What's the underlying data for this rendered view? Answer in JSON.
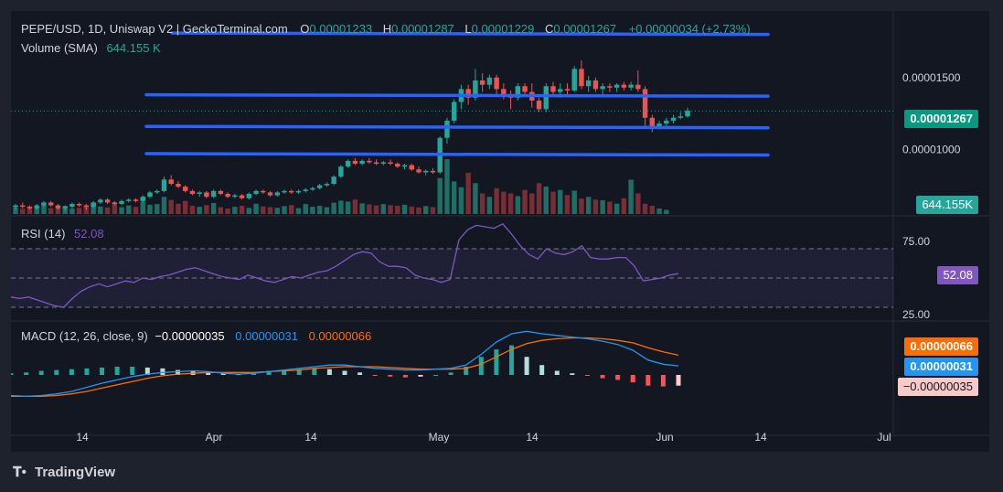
{
  "header": {
    "symbol": "PEPE/USD, 1D, Uniswap V2 | GeckoTerminal.com",
    "o_label": "O",
    "o_value": "0.00001233",
    "h_label": "H",
    "h_value": "0.00001287",
    "l_label": "L",
    "l_value": "0.00001229",
    "c_label": "C",
    "c_value": "0.00001267",
    "change": "+0.00000034 (+2.73%)",
    "volume_label": "Volume (SMA)",
    "volume_value": "644.155 K"
  },
  "price_axis": {
    "ticks": [
      {
        "label": "0.00001500",
        "value": 1.5e-05
      },
      {
        "label": "0.00001000",
        "value": 1e-05
      }
    ],
    "last_price_label": "0.00001267",
    "volume_badge": "644.155K"
  },
  "rsi": {
    "label": "RSI (14)",
    "value_label": "52.08",
    "ticks": [
      "75.00",
      "25.00"
    ],
    "badge": "52.08"
  },
  "macd": {
    "label": "MACD (12, 26, close, 9)",
    "hist_value": "−0.00000035",
    "macd_value": "0.00000031",
    "signal_value": "0.00000066",
    "badges": [
      "0.00000066",
      "0.00000031",
      "−0.00000035"
    ]
  },
  "time_axis": [
    "14",
    "Apr",
    "14",
    "May",
    "14",
    "Jun",
    "14",
    "Jul"
  ],
  "branding": "TradingView",
  "colors": {
    "up": "#26a69a",
    "down": "#ef5350",
    "level_line": "#2962ff",
    "rsi_line": "#7e57c2",
    "macd_line": "#2196f3",
    "signal_line": "#ff6d00"
  },
  "chart_data": {
    "type": "candlestick",
    "title": "PEPE/USD, 1D, Uniswap V2 | GeckoTerminal.com",
    "horizontal_levels": [
      1.81e-05,
      1.38e-05,
      1.16e-05,
      9.7e-06
    ],
    "last_close": 1.267e-05,
    "candles": [
      [
        6e-06,
        6.2e-06,
        5.8e-06,
        6.1e-06
      ],
      [
        6.1e-06,
        6.3e-06,
        5.9e-06,
        6e-06
      ],
      [
        6e-06,
        6.1e-06,
        5.8e-06,
        5.9e-06
      ],
      [
        5.9e-06,
        6.2e-06,
        5.8e-06,
        6.1e-06
      ],
      [
        6.1e-06,
        6.4e-06,
        6e-06,
        6.3e-06
      ],
      [
        6.3e-06,
        6.4e-06,
        6e-06,
        6.1e-06
      ],
      [
        6.1e-06,
        6.2e-06,
        5.8e-06,
        5.9e-06
      ],
      [
        5.9e-06,
        6.1e-06,
        5.7e-06,
        6e-06
      ],
      [
        6e-06,
        6.3e-06,
        5.9e-06,
        6.2e-06
      ],
      [
        6.2e-06,
        6.3e-06,
        6e-06,
        6.1e-06
      ],
      [
        6.1e-06,
        6.2e-06,
        5.8e-06,
        6e-06
      ],
      [
        6e-06,
        6.4e-06,
        5.9e-06,
        6.3e-06
      ],
      [
        6.3e-06,
        6.6e-06,
        6.2e-06,
        6.5e-06
      ],
      [
        6.5e-06,
        6.6e-06,
        6.2e-06,
        6.3e-06
      ],
      [
        6.3e-06,
        6.4e-06,
        6.1e-06,
        6.2e-06
      ],
      [
        6.2e-06,
        6.5e-06,
        6.1e-06,
        6.4e-06
      ],
      [
        6.4e-06,
        6.6e-06,
        6.3e-06,
        6.5e-06
      ],
      [
        6.5e-06,
        6.6e-06,
        6.3e-06,
        6.4e-06
      ],
      [
        6.4e-06,
        6.8e-06,
        6.3e-06,
        6.7e-06
      ],
      [
        6.7e-06,
        7.1e-06,
        6.6e-06,
        7e-06
      ],
      [
        7e-06,
        7.2e-06,
        6.9e-06,
        7.1e-06
      ],
      [
        7.1e-06,
        8.1e-06,
        7e-06,
        7.9e-06
      ],
      [
        7.9e-06,
        8.2e-06,
        7.5e-06,
        7.6e-06
      ],
      [
        7.6e-06,
        7.8e-06,
        7.3e-06,
        7.4e-06
      ],
      [
        7.4e-06,
        7.5e-06,
        7e-06,
        7.1e-06
      ],
      [
        7.1e-06,
        7.2e-06,
        6.8e-06,
        6.9e-06
      ],
      [
        6.9e-06,
        7.1e-06,
        6.7e-06,
        7e-06
      ],
      [
        7e-06,
        7.1e-06,
        6.6e-06,
        6.7e-06
      ],
      [
        6.7e-06,
        7.2e-06,
        6.6e-06,
        7.1e-06
      ],
      [
        7.1e-06,
        7.2e-06,
        6.8e-06,
        6.9e-06
      ],
      [
        6.9e-06,
        7e-06,
        6.6e-06,
        6.7e-06
      ],
      [
        6.7e-06,
        6.9e-06,
        6.6e-06,
        6.8e-06
      ],
      [
        6.8e-06,
        6.9e-06,
        6.5e-06,
        6.6e-06
      ],
      [
        6.6e-06,
        7e-06,
        6.5e-06,
        6.9e-06
      ],
      [
        6.9e-06,
        7.2e-06,
        6.8e-06,
        7.1e-06
      ],
      [
        7.1e-06,
        7.2e-06,
        6.9e-06,
        7e-06
      ],
      [
        7e-06,
        7.1e-06,
        6.7e-06,
        6.8e-06
      ],
      [
        6.8e-06,
        7.1e-06,
        6.7e-06,
        7e-06
      ],
      [
        7e-06,
        7.2e-06,
        6.9e-06,
        7.1e-06
      ],
      [
        7.1e-06,
        7.2e-06,
        6.9e-06,
        7e-06
      ],
      [
        7e-06,
        7.2e-06,
        6.9e-06,
        7.1e-06
      ],
      [
        7.1e-06,
        7.3e-06,
        7e-06,
        7.2e-06
      ],
      [
        7.2e-06,
        7.4e-06,
        7.1e-06,
        7.3e-06
      ],
      [
        7.3e-06,
        7.6e-06,
        7.2e-06,
        7.5e-06
      ],
      [
        7.5e-06,
        7.7e-06,
        7.4e-06,
        7.6e-06
      ],
      [
        7.6e-06,
        8.2e-06,
        7.5e-06,
        8.1e-06
      ],
      [
        8.1e-06,
        8.9e-06,
        8e-06,
        8.8e-06
      ],
      [
        8.8e-06,
        9.3e-06,
        8.7e-06,
        9.2e-06
      ],
      [
        9.2e-06,
        9.4e-06,
        8.9e-06,
        9e-06
      ],
      [
        9e-06,
        9.3e-06,
        8.9e-06,
        9.2e-06
      ],
      [
        9.2e-06,
        9.4e-06,
        9e-06,
        9.1e-06
      ],
      [
        9.1e-06,
        9.3e-06,
        8.9e-06,
        9e-06
      ],
      [
        9e-06,
        9.2e-06,
        8.9e-06,
        9.1e-06
      ],
      [
        9.1e-06,
        9.3e-06,
        8.9e-06,
        9e-06
      ],
      [
        9e-06,
        9.1e-06,
        8.7e-06,
        8.8e-06
      ],
      [
        8.8e-06,
        9e-06,
        8.6e-06,
        8.9e-06
      ],
      [
        8.9e-06,
        9e-06,
        8.5e-06,
        8.6e-06
      ],
      [
        8.6e-06,
        8.8e-06,
        8.3e-06,
        8.4e-06
      ],
      [
        8.4e-06,
        8.6e-06,
        8.2e-06,
        8.5e-06
      ],
      [
        8.5e-06,
        8.7e-06,
        8.3e-06,
        8.4e-06
      ],
      [
        8.4e-06,
        1.09e-05,
        8.3e-06,
        1.08e-05
      ],
      [
        1.08e-05,
        1.22e-05,
        1.04e-05,
        1.2e-05
      ],
      [
        1.2e-05,
        1.35e-05,
        1.18e-05,
        1.33e-05
      ],
      [
        1.33e-05,
        1.45e-05,
        1.28e-05,
        1.42e-05
      ],
      [
        1.42e-05,
        1.45e-05,
        1.31e-05,
        1.36e-05
      ],
      [
        1.36e-05,
        1.56e-05,
        1.34e-05,
        1.48e-05
      ],
      [
        1.48e-05,
        1.53e-05,
        1.4e-05,
        1.45e-05
      ],
      [
        1.45e-05,
        1.52e-05,
        1.42e-05,
        1.5e-05
      ],
      [
        1.5e-05,
        1.52e-05,
        1.38e-05,
        1.42e-05
      ],
      [
        1.42e-05,
        1.46e-05,
        1.35e-05,
        1.38e-05
      ],
      [
        1.38e-05,
        1.41e-05,
        1.28e-05,
        1.36e-05
      ],
      [
        1.36e-05,
        1.46e-05,
        1.34e-05,
        1.44e-05
      ],
      [
        1.44e-05,
        1.46e-05,
        1.38e-05,
        1.4e-05
      ],
      [
        1.4e-05,
        1.46e-05,
        1.29e-05,
        1.34e-05
      ],
      [
        1.34e-05,
        1.36e-05,
        1.26e-05,
        1.28e-05
      ],
      [
        1.28e-05,
        1.46e-05,
        1.26e-05,
        1.44e-05
      ],
      [
        1.44e-05,
        1.47e-05,
        1.38e-05,
        1.4e-05
      ],
      [
        1.4e-05,
        1.46e-05,
        1.36e-05,
        1.42e-05
      ],
      [
        1.42e-05,
        1.46e-05,
        1.38e-05,
        1.41e-05
      ],
      [
        1.41e-05,
        1.58e-05,
        1.4e-05,
        1.56e-05
      ],
      [
        1.56e-05,
        1.62e-05,
        1.42e-05,
        1.44e-05
      ],
      [
        1.44e-05,
        1.51e-05,
        1.4e-05,
        1.48e-05
      ],
      [
        1.48e-05,
        1.5e-05,
        1.4e-05,
        1.42e-05
      ],
      [
        1.42e-05,
        1.46e-05,
        1.38e-05,
        1.44e-05
      ],
      [
        1.44e-05,
        1.46e-05,
        1.4e-05,
        1.43e-05
      ],
      [
        1.43e-05,
        1.46e-05,
        1.4e-05,
        1.45e-05
      ],
      [
        1.45e-05,
        1.47e-05,
        1.41e-05,
        1.43e-05
      ],
      [
        1.43e-05,
        1.47e-05,
        1.41e-05,
        1.45e-05
      ],
      [
        1.45e-05,
        1.55e-05,
        1.4e-05,
        1.42e-05
      ],
      [
        1.42e-05,
        1.44e-05,
        1.16e-05,
        1.22e-05
      ],
      [
        1.22e-05,
        1.24e-05,
        1.12e-05,
        1.16e-05
      ],
      [
        1.16e-05,
        1.2e-05,
        1.14e-05,
        1.18e-05
      ],
      [
        1.18e-05,
        1.22e-05,
        1.16e-05,
        1.2e-05
      ],
      [
        1.2e-05,
        1.24e-05,
        1.18e-05,
        1.22e-05
      ],
      [
        1.22e-05,
        1.26e-05,
        1.21e-05,
        1.23e-05
      ],
      [
        1.23e-05,
        1.29e-05,
        1.22e-05,
        1.27e-05
      ]
    ],
    "volume": [
      2,
      1.5,
      2.2,
      1.8,
      2.6,
      1.7,
      1.9,
      2.4,
      1.6,
      1.8,
      2.3,
      3.1,
      2.2,
      1.9,
      3.4,
      2.0,
      2.5,
      2.1,
      3.6,
      2.7,
      2.9,
      5.0,
      4.1,
      3.0,
      3.8,
      2.4,
      2.1,
      2.6,
      3.2,
      2.0,
      1.6,
      2.1,
      2.4,
      1.8,
      3.0,
      2.2,
      2.0,
      1.8,
      2.3,
      2.6,
      1.7,
      2.9,
      2.1,
      2.4,
      2.0,
      3.3,
      3.9,
      3.6,
      4.2,
      3.1,
      2.8,
      2.5,
      2.9,
      2.6,
      2.4,
      2.7,
      2.2,
      1.9,
      2.3,
      2.0,
      10.5,
      16.0,
      9.5,
      7.8,
      12.0,
      9.0,
      6.0,
      5.0,
      7.5,
      6.5,
      6.0,
      5.2,
      7.0,
      6.0,
      9.0,
      8.0,
      6.5,
      7.0,
      5.5,
      6.8,
      4.5,
      5.0,
      4.2,
      4.0,
      3.6,
      3.0,
      4.6,
      10.0,
      6.0,
      3.0,
      2.4,
      1.6,
      1.2
    ],
    "rsi_values": [
      37,
      36,
      37,
      35,
      33,
      31,
      30,
      36,
      41,
      44,
      46,
      44,
      46,
      48,
      47,
      50,
      49,
      51,
      52,
      54,
      56,
      57,
      55,
      53,
      51,
      50,
      49,
      52,
      50,
      48,
      47,
      49,
      51,
      50,
      52,
      54,
      55,
      58,
      62,
      66,
      68,
      67,
      61,
      58,
      58,
      57,
      52,
      50,
      49,
      47,
      49,
      76,
      83,
      86,
      85,
      84,
      87,
      80,
      72,
      66,
      63,
      70,
      67,
      66,
      68,
      72,
      64,
      63,
      63,
      64,
      64,
      58,
      48,
      49,
      50,
      52,
      53
    ],
    "macd_line": [
      -2.5,
      -2.6,
      -2.5,
      -2.3,
      -2.0,
      -1.5,
      -1.0,
      -0.6,
      -0.2,
      0.1,
      0.3,
      0.4,
      0.5,
      0.4,
      0.2,
      0.1,
      0.2,
      0.4,
      0.6,
      0.8,
      1.0,
      1.2,
      1.2,
      1.0,
      0.8,
      0.7,
      0.6,
      0.6,
      0.7,
      0.8,
      1.2,
      2.5,
      4.0,
      5.0,
      5.3,
      5.0,
      4.8,
      4.6,
      4.4,
      4.1,
      3.7,
      3.0,
      1.8,
      1.3,
      1.1
    ],
    "signal_line": [
      -2.6,
      -2.6,
      -2.6,
      -2.5,
      -2.3,
      -2.0,
      -1.6,
      -1.2,
      -0.8,
      -0.4,
      -0.1,
      0.1,
      0.2,
      0.3,
      0.3,
      0.3,
      0.3,
      0.4,
      0.5,
      0.6,
      0.8,
      0.9,
      1.0,
      1.0,
      1.0,
      0.9,
      0.8,
      0.7,
      0.7,
      0.7,
      0.8,
      1.3,
      2.2,
      3.1,
      3.8,
      4.2,
      4.4,
      4.5,
      4.5,
      4.4,
      4.2,
      3.9,
      3.3,
      2.8,
      2.4
    ],
    "macd_hist": [
      0.2,
      0.3,
      0.5,
      0.6,
      0.7,
      0.8,
      0.9,
      1.0,
      1.0,
      0.9,
      0.8,
      0.6,
      0.5,
      0.4,
      0.2,
      0.1,
      0.3,
      0.5,
      0.6,
      0.7,
      0.8,
      0.7,
      0.5,
      0.3,
      -0.1,
      -0.2,
      -0.3,
      -0.2,
      0.0,
      0.3,
      1.0,
      2.2,
      3.1,
      3.6,
      2.2,
      1.2,
      0.5,
      0.2,
      -0.1,
      -0.4,
      -0.6,
      -0.9,
      -1.3,
      -1.4,
      -1.3
    ]
  }
}
